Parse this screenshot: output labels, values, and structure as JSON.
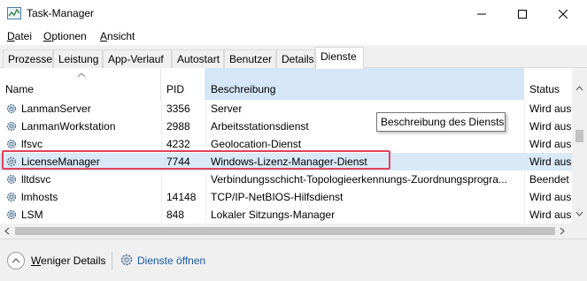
{
  "window": {
    "title": "Task-Manager",
    "controls": {
      "minimize": "—",
      "maximize": "☐",
      "close": "✕"
    },
    "icon": "task-manager-icon"
  },
  "menu": {
    "items": [
      {
        "label": "Datei",
        "accel": "D",
        "rest": "atei"
      },
      {
        "label": "Optionen",
        "accel": "O",
        "rest": "ptionen"
      },
      {
        "label": "Ansicht",
        "accel": "A",
        "rest": "nsicht"
      }
    ]
  },
  "tabs": [
    {
      "label": "Prozesse"
    },
    {
      "label": "Leistung"
    },
    {
      "label": "App-Verlauf"
    },
    {
      "label": "Autostart"
    },
    {
      "label": "Benutzer"
    },
    {
      "label": "Details"
    },
    {
      "label": "Dienste",
      "active": true
    }
  ],
  "columns": {
    "name": "Name",
    "pid": "PID",
    "description": "Beschreibung",
    "status": "Status"
  },
  "rows": [
    {
      "name": "LanmanServer",
      "pid": "3356",
      "description": "Server",
      "status": "Wird aus"
    },
    {
      "name": "LanmanWorkstation",
      "pid": "2988",
      "description": "Arbeitsstationsdienst",
      "status": "Wird aus"
    },
    {
      "name": "lfsvc",
      "pid": "4232",
      "description": "Geolocation-Dienst",
      "status": "Wird aus"
    },
    {
      "name": "LicenseManager",
      "pid": "7744",
      "description": "Windows-Lizenz-Manager-Dienst",
      "status": "Wird aus",
      "selected": true
    },
    {
      "name": "lltdsvc",
      "pid": "",
      "description": "Verbindungsschicht-Topologieerkennungs-Zuordnungsprogra...",
      "status": "Beendet"
    },
    {
      "name": "lmhosts",
      "pid": "14148",
      "description": "TCP/IP-NetBIOS-Hilfsdienst",
      "status": "Wird aus"
    },
    {
      "name": "LSM",
      "pid": "848",
      "description": "Lokaler Sitzungs-Manager",
      "status": "Wird aus"
    }
  ],
  "tooltip": "Beschreibung des Diensts",
  "footer": {
    "less_details": {
      "accel": "W",
      "rest": "eniger Details"
    },
    "open_services": "Dienste öffnen"
  },
  "colors": {
    "selected_header": "#d4e6f7",
    "selected_row": "#d9e9f8",
    "highlight_border": "#e0435a",
    "link": "#1a5aa6"
  }
}
